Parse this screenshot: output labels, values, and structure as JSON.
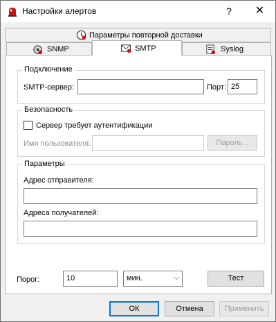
{
  "window": {
    "title": "Настройки алертов",
    "help_label": "?",
    "close_label": "✕"
  },
  "tabs": {
    "redelivery": "Параметры повторной доставки",
    "snmp": "SNMP",
    "smtp": "SMTP",
    "syslog": "Syslog"
  },
  "connection": {
    "group_title": "Подключение",
    "server_label": "SMTP-сервер:",
    "server_value": "",
    "port_label": "Порт:",
    "port_value": "25"
  },
  "security": {
    "group_title": "Безопасность",
    "auth_label": "Сервер требует аутентификации",
    "auth_checked": false,
    "username_label": "Имя пользователя:",
    "username_value": "",
    "password_button": "Пароль..."
  },
  "parameters": {
    "group_title": "Параметры",
    "sender_label": "Адрес отправителя:",
    "sender_value": "",
    "recipients_label": "Адреса получателей:",
    "recipients_value": ""
  },
  "threshold": {
    "label": "Порог:",
    "value": "10",
    "unit_selected": "мин.",
    "test_button": "Тест"
  },
  "footer": {
    "ok": "ОК",
    "cancel": "Отмена",
    "apply": "Применить"
  }
}
